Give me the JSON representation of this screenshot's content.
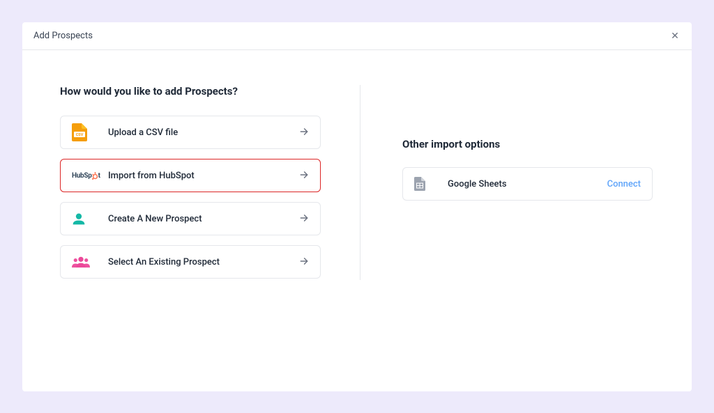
{
  "modal": {
    "title": "Add Prospects",
    "close_symbol": "✕"
  },
  "left": {
    "heading": "How would you like to add Prospects?",
    "options": [
      {
        "label": "Upload a CSV file"
      },
      {
        "label": "Import from HubSpot"
      },
      {
        "label": "Create A New Prospect"
      },
      {
        "label": "Select An Existing Prospect"
      }
    ]
  },
  "right": {
    "heading": "Other import options",
    "items": [
      {
        "label": "Google Sheets",
        "action": "Connect"
      }
    ]
  }
}
